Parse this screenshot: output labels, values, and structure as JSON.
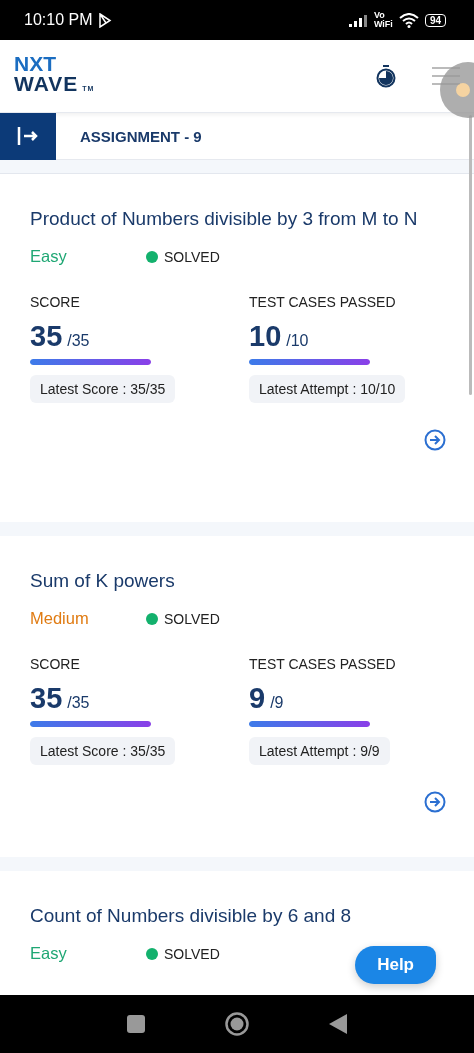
{
  "status_bar": {
    "time": "10:10 PM",
    "network": "Vo\nWiFi",
    "battery": "94"
  },
  "header": {
    "logo_top": "NXT",
    "logo_bottom": "WAVE",
    "logo_mark": "TM"
  },
  "assignment_bar": {
    "title": "ASSIGNMENT - 9"
  },
  "questions": [
    {
      "title": "Product of Numbers divisible by 3 from M to N",
      "difficulty": {
        "label": "Easy",
        "color": "#1fa774"
      },
      "status": {
        "label": "SOLVED",
        "color": "#13b16d"
      },
      "score": {
        "label": "SCORE",
        "value": "35",
        "total": "/35",
        "level": 1,
        "latest": "Latest Score : 35/35"
      },
      "tests": {
        "label": "TEST CASES PASSED",
        "value": "10",
        "total": "/10",
        "level": 1,
        "latest": "Latest Attempt : 10/10"
      }
    },
    {
      "title": "Sum of K powers",
      "difficulty": {
        "label": "Medium",
        "color": "#e07b12"
      },
      "status": {
        "label": "SOLVED",
        "color": "#13b16d"
      },
      "score": {
        "label": "SCORE",
        "value": "35",
        "total": "/35",
        "level": 1,
        "latest": "Latest Score : 35/35"
      },
      "tests": {
        "label": "TEST CASES PASSED",
        "value": "9",
        "total": "/9",
        "level": 1,
        "latest": "Latest Attempt : 9/9"
      }
    },
    {
      "title": "Count of Numbers divisible by 6 and 8",
      "difficulty": {
        "label": "Easy",
        "color": "#1fa774"
      },
      "status": {
        "label": "SOLVED",
        "color": "#13b16d"
      }
    }
  ],
  "help_button": "Help"
}
